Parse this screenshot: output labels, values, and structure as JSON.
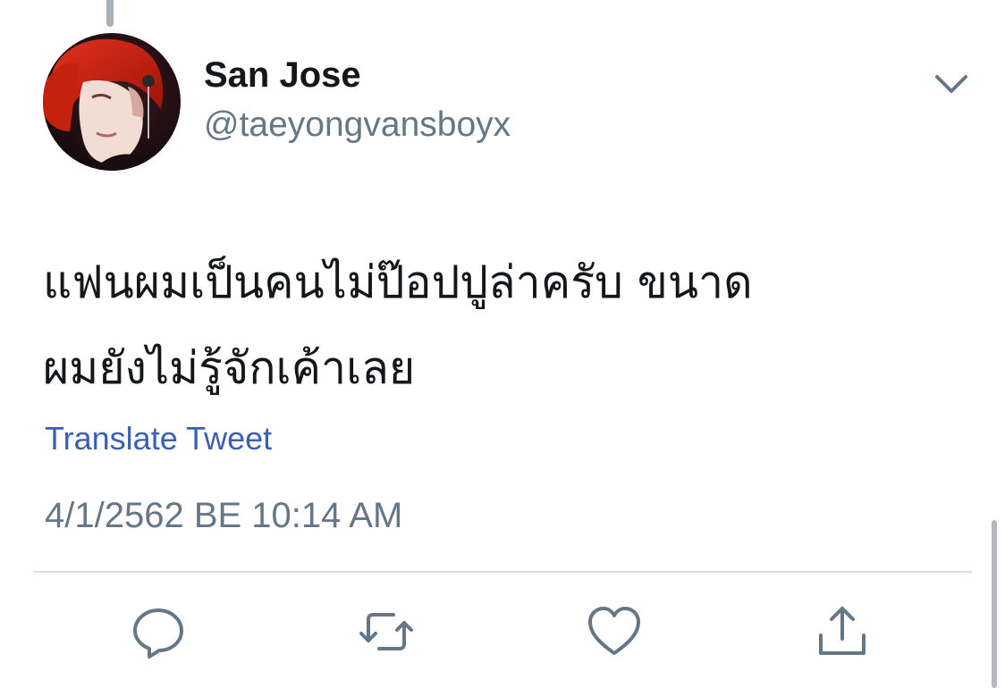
{
  "tweet": {
    "author": {
      "display_name": "San Jose",
      "handle": "@taeyongvansboyx",
      "avatar": "avatar-red-hair-portrait"
    },
    "text_lines": [
      "แฟนผมเป็นคนไม่ป๊อปปูล่าครับ ขนาด",
      "ผมยังไม่รู้จักเค้าเลย"
    ],
    "translate_label": "Translate Tweet",
    "timestamp": "4/1/2562 BE 10:14 AM"
  },
  "actions": [
    {
      "name": "reply",
      "icon": "reply-icon"
    },
    {
      "name": "retweet",
      "icon": "retweet-icon"
    },
    {
      "name": "like",
      "icon": "heart-icon"
    },
    {
      "name": "share",
      "icon": "share-icon"
    }
  ],
  "menu": {
    "icon": "chevron-down-icon"
  },
  "colors": {
    "text": "#14171a",
    "secondary": "#657786",
    "link": "#3b5fb5",
    "divider": "#d9dde1"
  }
}
